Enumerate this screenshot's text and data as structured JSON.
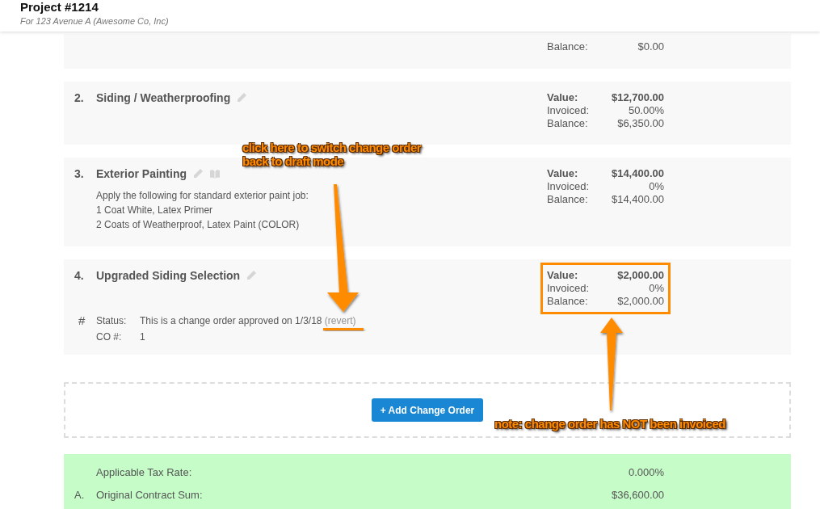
{
  "header": {
    "title": "Project #1214",
    "subtitle": "For 123 Avenue A (Awesome Co, Inc)"
  },
  "items": [
    {
      "stats": [
        {
          "kind": "plain",
          "label": "Balance:",
          "value": "$0.00"
        }
      ]
    },
    {
      "number": "2.",
      "title": "Siding / Weatherproofing",
      "editable": true,
      "has_notes": false,
      "stats": [
        {
          "kind": "value",
          "label": "Value:",
          "value": "$12,700.00"
        },
        {
          "kind": "plain",
          "label": "Invoiced:",
          "value": "50.00%"
        },
        {
          "kind": "plain",
          "label": "Balance:",
          "value": "$6,350.00"
        }
      ]
    },
    {
      "number": "3.",
      "title": "Exterior Painting",
      "editable": true,
      "has_notes": true,
      "description": [
        "Apply the following for standard exterior paint job:",
        "1 Coat White, Latex Primer",
        "2 Coats of Weatherproof, Latex Paint (COLOR)"
      ],
      "stats": [
        {
          "kind": "value",
          "label": "Value:",
          "value": "$14,400.00"
        },
        {
          "kind": "plain",
          "label": "Invoiced:",
          "value": "0%"
        },
        {
          "kind": "plain",
          "label": "Balance:",
          "value": "$14,400.00"
        }
      ]
    },
    {
      "number": "4.",
      "title": "Upgraded Siding Selection",
      "editable": true,
      "has_notes": false,
      "highlighted": true,
      "marker": "#",
      "details": [
        {
          "label": "Status:",
          "text": "This is a change order approved on 1/3/18",
          "link": "(revert)"
        },
        {
          "label": "CO #:",
          "text": "1"
        }
      ],
      "stats": [
        {
          "kind": "value",
          "label": "Value:",
          "value": "$2,000.00"
        },
        {
          "kind": "plain",
          "label": "Invoiced:",
          "value": "0%"
        },
        {
          "kind": "plain",
          "label": "Balance:",
          "value": "$2,000.00"
        }
      ]
    }
  ],
  "add_button": "+ Add Change Order",
  "summary": [
    {
      "label": "Applicable Tax Rate:",
      "value": "0.000%"
    },
    {
      "letter": "A.",
      "label": "Original Contract Sum:",
      "value": "$36,600.00"
    }
  ],
  "annotations": [
    {
      "kind": "callout",
      "lines": [
        "click here to switch change order",
        "back to draft mode"
      ]
    },
    {
      "kind": "note",
      "lines": [
        "note: change order has NOT been invoiced"
      ]
    }
  ]
}
